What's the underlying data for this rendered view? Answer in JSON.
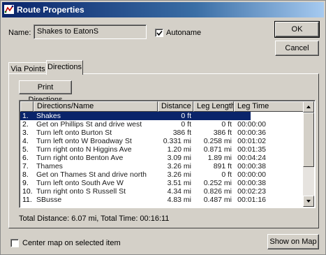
{
  "window": {
    "title": "Route Properties"
  },
  "name_label": "Name:",
  "name_value": "Shakes to EatonS",
  "autoname": {
    "label": "Autoname",
    "checked": true
  },
  "buttons": {
    "ok": "OK",
    "cancel": "Cancel",
    "print_directions": "Print Directions",
    "show_on_map": "Show on Map"
  },
  "tabs": [
    {
      "label": "Via Points",
      "active": false
    },
    {
      "label": "Directions",
      "active": true
    }
  ],
  "table": {
    "columns": [
      "Directions/Name",
      "Distance",
      "Leg Length",
      "Leg Time"
    ],
    "rows": [
      {
        "num": "1.",
        "name": "Shakes",
        "distance": "0 ft",
        "leg_length": "",
        "leg_time": "",
        "selected": true
      },
      {
        "num": "2.",
        "name": "Get on Phillips St and drive west",
        "distance": "0 ft",
        "leg_length": "0 ft",
        "leg_time": "00:00:00"
      },
      {
        "num": "3.",
        "name": "Turn left onto Burton St",
        "distance": "386 ft",
        "leg_length": "386 ft",
        "leg_time": "00:00:36"
      },
      {
        "num": "4.",
        "name": "Turn left onto W Broadway St",
        "distance": "0.331 mi",
        "leg_length": "0.258 mi",
        "leg_time": "00:01:02"
      },
      {
        "num": "5.",
        "name": "Turn right onto N Higgins Ave",
        "distance": "1.20 mi",
        "leg_length": "0.871 mi",
        "leg_time": "00:01:35"
      },
      {
        "num": "6.",
        "name": "Turn right onto Benton Ave",
        "distance": "3.09 mi",
        "leg_length": "1.89 mi",
        "leg_time": "00:04:24"
      },
      {
        "num": "7.",
        "name": "Thames",
        "distance": "3.26 mi",
        "leg_length": "891 ft",
        "leg_time": "00:00:38"
      },
      {
        "num": "8.",
        "name": "Get on Thames St and drive north",
        "distance": "3.26 mi",
        "leg_length": "0 ft",
        "leg_time": "00:00:00"
      },
      {
        "num": "9.",
        "name": "Turn left onto South Ave W",
        "distance": "3.51 mi",
        "leg_length": "0.252 mi",
        "leg_time": "00:00:38"
      },
      {
        "num": "10.",
        "name": "Turn right onto S Russell St",
        "distance": "4.34 mi",
        "leg_length": "0.826 mi",
        "leg_time": "00:02:23"
      },
      {
        "num": "11.",
        "name": "SBusse",
        "distance": "4.83 mi",
        "leg_length": "0.487 mi",
        "leg_time": "00:01:16"
      }
    ]
  },
  "totals": "Total Distance: 6.07 mi, Total Time: 00:16:11",
  "center_map": {
    "label": "Center map on selected item",
    "checked": false
  },
  "colors": {
    "titlebar": "#0a246a",
    "selection": "#0a246a",
    "face": "#d4d0c8"
  },
  "icons": {
    "app": "route-app-icon",
    "check": "check-icon",
    "scroll_up": "arrow-up-icon",
    "scroll_down": "arrow-down-icon"
  }
}
